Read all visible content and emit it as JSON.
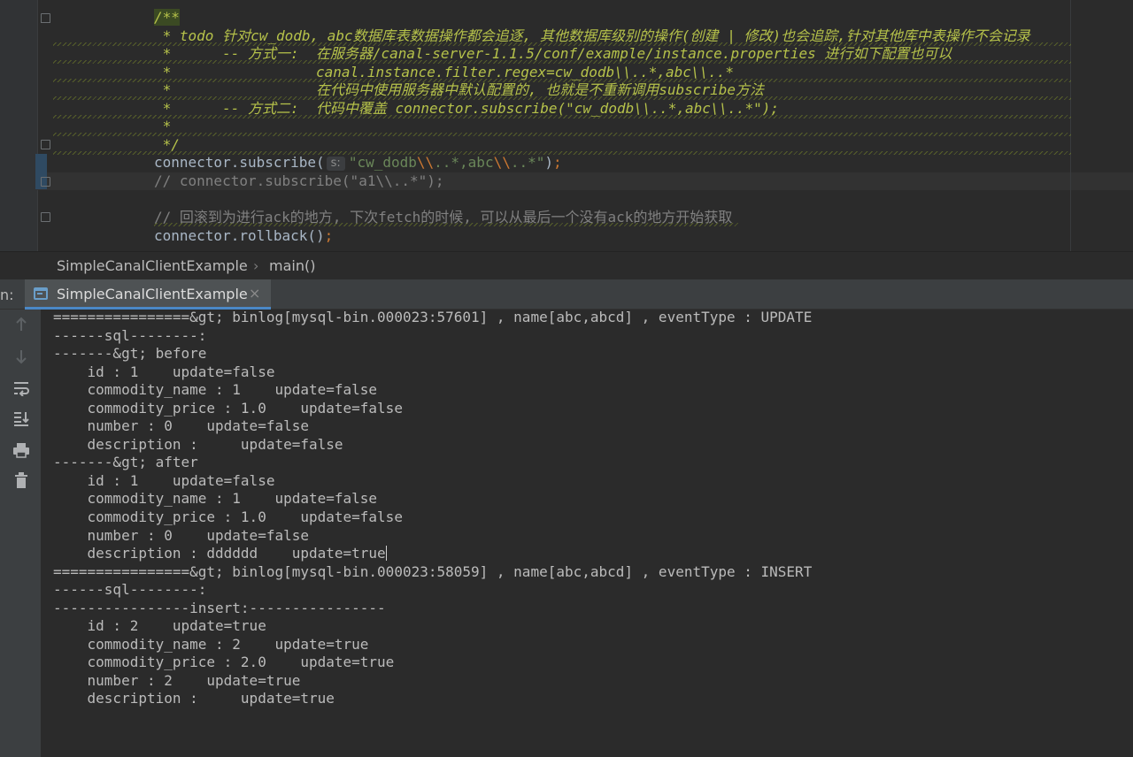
{
  "editor": {
    "doc_lines": [
      "/**",
      " * todo 针对cw_dodb, abc数据库表数据操作都会追逐, 其他数据库级别的操作(创建 | 修改)也会追踪,针对其他库中表操作不会记录",
      " *      -- 方式一:  在服务器/canal-server-1.1.5/conf/example/instance.properties 进行如下配置也可以",
      " *                 canal.instance.filter.regex=cw_dodb\\\\..*,abc\\\\..*",
      " *                 在代码中使用服务器中默认配置的, 也就是不重新调用subscribe方法",
      " *      -- 方式二:  代码中覆盖 connector.subscribe(\"cw_dodb\\\\..*,abc\\\\..*\");",
      " *",
      " */"
    ],
    "subscribe_call": {
      "prefix": "connector.subscribe(",
      "hint": "s:",
      "str_open": "\"cw_dodb",
      "esc1": "\\\\",
      "str_mid": "..*,abc",
      "esc2": "\\\\",
      "str_close": "..*\"",
      "suffix_paren": ")",
      "suffix_semi": ";"
    },
    "commented_subscribe": "// connector.subscribe(\"a1\\\\..*\");",
    "rollback_comment": "// 回滚到为进行ack的地方, 下次fetch的时候, 可以从最后一个没有ack的地方开始获取",
    "rollback_call": {
      "text": "connector.rollback(",
      "paren": ")",
      "semi": ";"
    }
  },
  "breadcrumb": {
    "class_name": "SimpleCanalClientExample",
    "separator": "›",
    "method": "main()"
  },
  "run_panel": {
    "label": "n:",
    "tab_label": "SimpleCanalClientExample",
    "close_glyph": "×",
    "toolbar_icons": [
      "up-arrow-icon",
      "down-arrow-icon",
      "soft-wrap-icon",
      "scroll-to-end-icon",
      "print-icon",
      "trash-icon"
    ]
  },
  "console": {
    "lines": [
      "================&gt; binlog[mysql-bin.000023:57601] , name[abc,abcd] , eventType : UPDATE",
      "------sql--------:",
      "-------&gt; before",
      "    id : 1    update=false",
      "    commodity_name : 1    update=false",
      "    commodity_price : 1.0    update=false",
      "    number : 0    update=false",
      "    description :     update=false",
      "-------&gt; after",
      "    id : 1    update=false",
      "    commodity_name : 1    update=false",
      "    commodity_price : 1.0    update=false",
      "    number : 0    update=false",
      "    description : dddddd    update=true",
      "================&gt; binlog[mysql-bin.000023:58059] , name[abc,abcd] , eventType : INSERT",
      "------sql--------:",
      "----------------insert:----------------",
      "    id : 2    update=true",
      "    commodity_name : 2    update=true",
      "    commodity_price : 2.0    update=true",
      "    number : 2    update=true",
      "    description :     update=true"
    ]
  },
  "colors": {
    "editor_bg": "#2b2b2b",
    "doc_comment": "#b6c24a",
    "line_comment": "#808080",
    "string": "#6a8759",
    "keyword_punct": "#cc7832",
    "identifier": "#a9b7c6",
    "toolwindow_bg": "#3c3f41",
    "tab_underline": "#4a88c7"
  }
}
